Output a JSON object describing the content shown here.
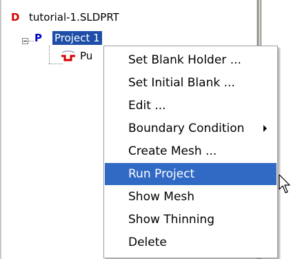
{
  "tree": {
    "root": {
      "icon_letter": "D",
      "label": "tutorial-1.SLDPRT"
    },
    "project": {
      "icon_letter": "P",
      "label": "Project 1"
    },
    "child": {
      "label": "Pu"
    }
  },
  "context_menu": {
    "items": [
      {
        "label": "Set Blank Holder ...",
        "has_submenu": false
      },
      {
        "label": "Set Initial Blank ...",
        "has_submenu": false
      },
      {
        "label": "Edit ...",
        "has_submenu": false
      },
      {
        "label": "Boundary Condition",
        "has_submenu": true
      },
      {
        "label": "Create Mesh ...",
        "has_submenu": false
      },
      {
        "label": "Run Project",
        "has_submenu": false,
        "highlighted": true
      },
      {
        "label": "Show Mesh",
        "has_submenu": false
      },
      {
        "label": "Show Thinning",
        "has_submenu": false
      },
      {
        "label": "Delete",
        "has_submenu": false
      }
    ]
  },
  "colors": {
    "selection": "#316ac5",
    "document_icon": "#d40000",
    "project_icon": "#0000c8",
    "punch_icon": "#d40000"
  },
  "icons": {
    "document": "document-icon",
    "project": "project-icon",
    "punch": "punch-tool-icon",
    "expander": "collapse-minus-icon",
    "submenu": "submenu-arrow-icon",
    "cursor": "mouse-pointer-icon"
  }
}
